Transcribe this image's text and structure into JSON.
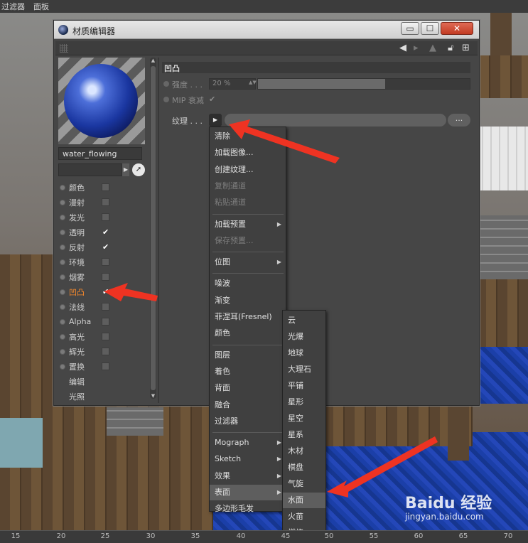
{
  "menubar": {
    "items": [
      "过滤器",
      "面板"
    ]
  },
  "window": {
    "title": "材质编辑器",
    "min_label": "▭",
    "max_label": "☐",
    "close_label": "✕"
  },
  "material": {
    "name": "water_flowing"
  },
  "channels": [
    {
      "label": "颜色",
      "checked": false
    },
    {
      "label": "漫射",
      "checked": false
    },
    {
      "label": "发光",
      "checked": false
    },
    {
      "label": "透明",
      "checked": true
    },
    {
      "label": "反射",
      "checked": true
    },
    {
      "label": "环境",
      "checked": false
    },
    {
      "label": "烟雾",
      "checked": false
    },
    {
      "label": "凹凸",
      "checked": true,
      "active": true
    },
    {
      "label": "法线",
      "checked": false
    },
    {
      "label": "Alpha",
      "checked": false
    },
    {
      "label": "高光",
      "checked": false
    },
    {
      "label": "辉光",
      "checked": false
    },
    {
      "label": "置换",
      "checked": false
    }
  ],
  "extra_items": [
    "编辑",
    "光照"
  ],
  "bump": {
    "section_title": "凹凸",
    "strength_label": "强度 . . .",
    "strength_value": "20 %",
    "strength_fraction": 0.6,
    "mip_label": "MIP 衰减",
    "mip_check": "✔",
    "texture_label": "纹理 . . .",
    "texture_more": "..."
  },
  "texture_menu": [
    {
      "label": "清除"
    },
    {
      "label": "加载图像..."
    },
    {
      "label": "创建纹理..."
    },
    {
      "label": "复制通道",
      "disabled": true
    },
    {
      "label": "粘贴通道",
      "disabled": true
    },
    {
      "sep": true
    },
    {
      "label": "加载预置",
      "submenu": true
    },
    {
      "label": "保存预置...",
      "disabled": true
    },
    {
      "sep": true
    },
    {
      "label": "位图",
      "submenu": true
    },
    {
      "sep": true
    },
    {
      "label": "噪波"
    },
    {
      "label": "渐变"
    },
    {
      "label": "菲涅耳(Fresnel)"
    },
    {
      "label": "颜色"
    },
    {
      "sep": true
    },
    {
      "label": "图层"
    },
    {
      "label": "着色"
    },
    {
      "label": "背面"
    },
    {
      "label": "融合"
    },
    {
      "label": "过滤器"
    },
    {
      "sep": true
    },
    {
      "label": "Mograph",
      "submenu": true
    },
    {
      "label": "Sketch",
      "submenu": true
    },
    {
      "label": "效果",
      "submenu": true
    },
    {
      "label": "表面",
      "submenu": true,
      "selected": true
    },
    {
      "label": "多边形毛发"
    }
  ],
  "surface_menu": [
    {
      "label": "云"
    },
    {
      "label": "光爆"
    },
    {
      "label": "地球"
    },
    {
      "label": "大理石"
    },
    {
      "label": "平铺"
    },
    {
      "label": "星形"
    },
    {
      "label": "星空"
    },
    {
      "label": "星系"
    },
    {
      "label": "木材"
    },
    {
      "label": "棋盘"
    },
    {
      "label": "气旋"
    },
    {
      "label": "水面",
      "selected": true
    },
    {
      "label": "火苗"
    },
    {
      "label": "燃烧"
    }
  ],
  "ruler": {
    "ticks": [
      "15",
      "20",
      "25",
      "30",
      "35",
      "40",
      "45",
      "50",
      "55",
      "60",
      "65",
      "70"
    ]
  },
  "watermark": {
    "logo": "Baidu 经验",
    "url": "jingyan.baidu.com"
  },
  "colors": {
    "accent_active": "#ff8c2a",
    "annotation_red": "#ee3322",
    "close_button": "#c13a22"
  }
}
